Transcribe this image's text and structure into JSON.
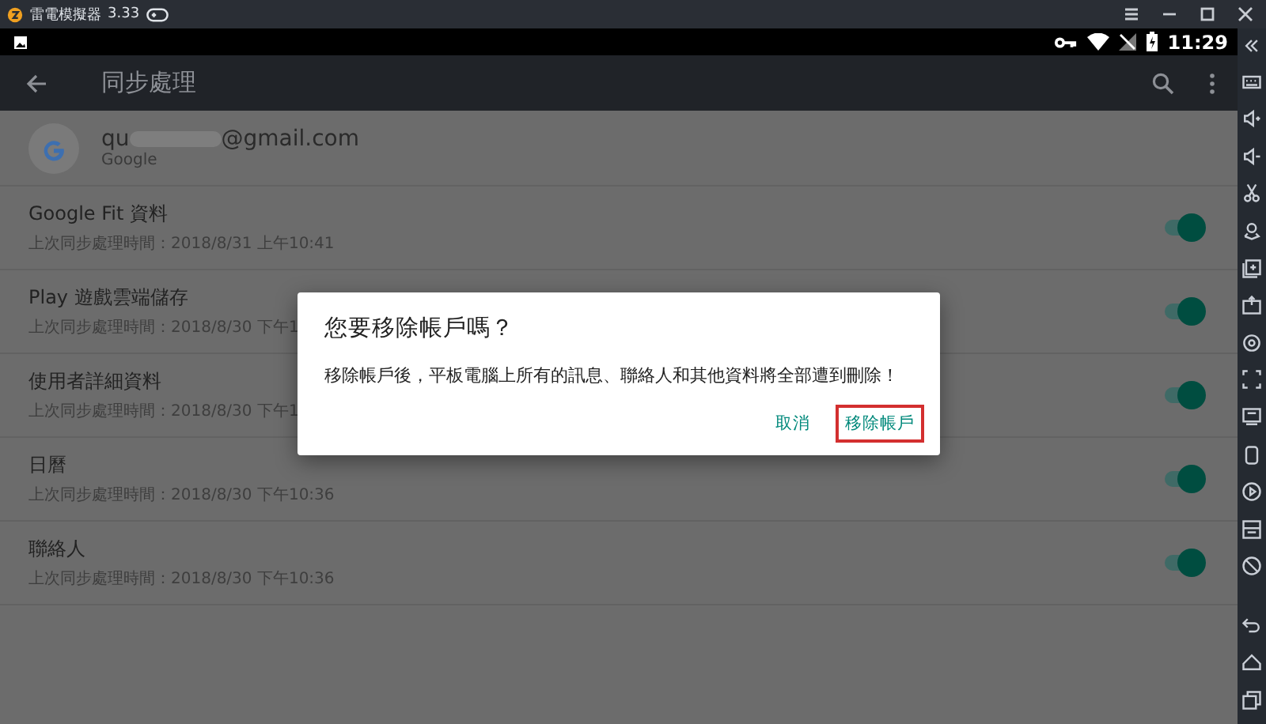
{
  "emulator": {
    "app_name": "雷電模擬器",
    "version": "3.33"
  },
  "status_bar": {
    "time": "11:29"
  },
  "app_bar": {
    "title": "同步處理"
  },
  "account": {
    "email_start": "qu",
    "email_end": "@gmail.com",
    "provider": "Google"
  },
  "items": [
    {
      "name": "Google Fit 資料",
      "last_sync": "上次同步處理時間：2018/8/31 上午10:41",
      "on": true
    },
    {
      "name": "Play 遊戲雲端儲存",
      "last_sync": "上次同步處理時間：2018/8/30 下午1",
      "on": true
    },
    {
      "name": "使用者詳細資料",
      "last_sync": "上次同步處理時間：2018/8/30 下午1",
      "on": true
    },
    {
      "name": "日曆",
      "last_sync": "上次同步處理時間：2018/8/30 下午10:36",
      "on": true
    },
    {
      "name": "聯絡人",
      "last_sync": "上次同步處理時間：2018/8/30 下午10:36",
      "on": true
    }
  ],
  "dialog": {
    "title": "您要移除帳戶嗎？",
    "message": "移除帳戶後，平板電腦上所有的訊息、聯絡人和其他資料將全部遭到刪除！",
    "buttons": [
      {
        "label": "取消",
        "highlighted": false
      },
      {
        "label": "移除帳戶",
        "highlighted": true
      }
    ]
  }
}
